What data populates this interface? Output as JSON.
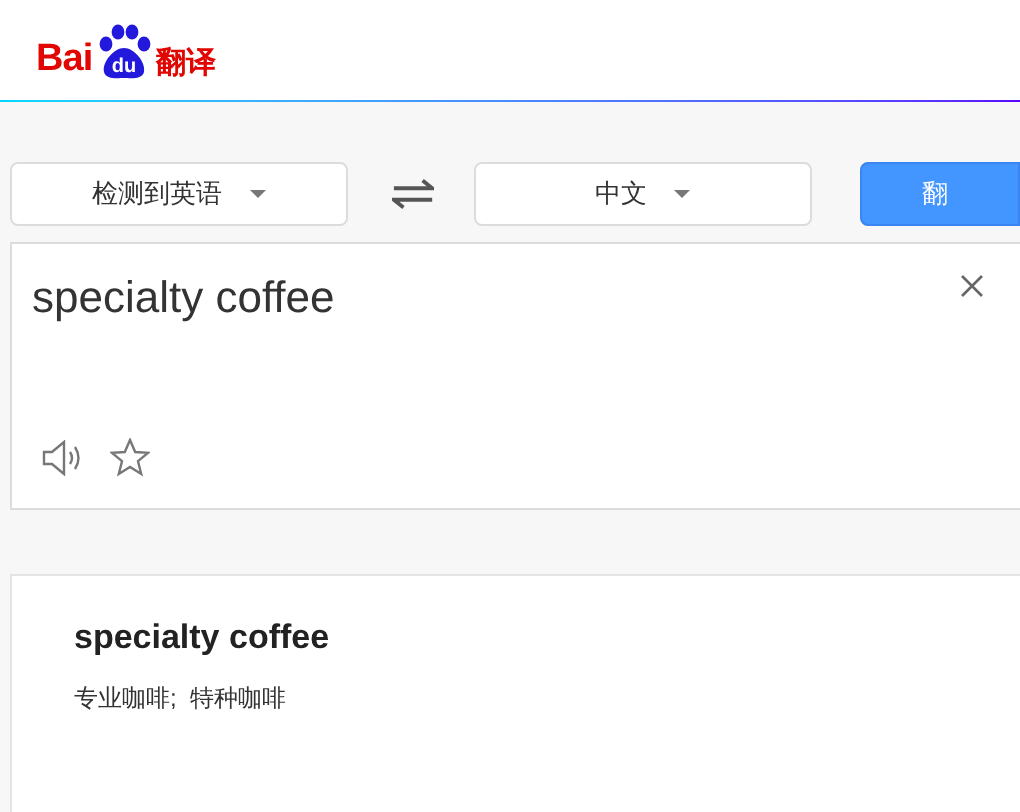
{
  "logo": {
    "latin": "Bai",
    "paw": "du",
    "name": "翻译"
  },
  "source_language": {
    "label": "检测到英语"
  },
  "target_language": {
    "label": "中文"
  },
  "translate_button": {
    "label": "翻"
  },
  "input": {
    "value": "specialty coffee"
  },
  "result": {
    "term": "specialty coffee",
    "translation": "专业咖啡;  特种咖啡"
  }
}
